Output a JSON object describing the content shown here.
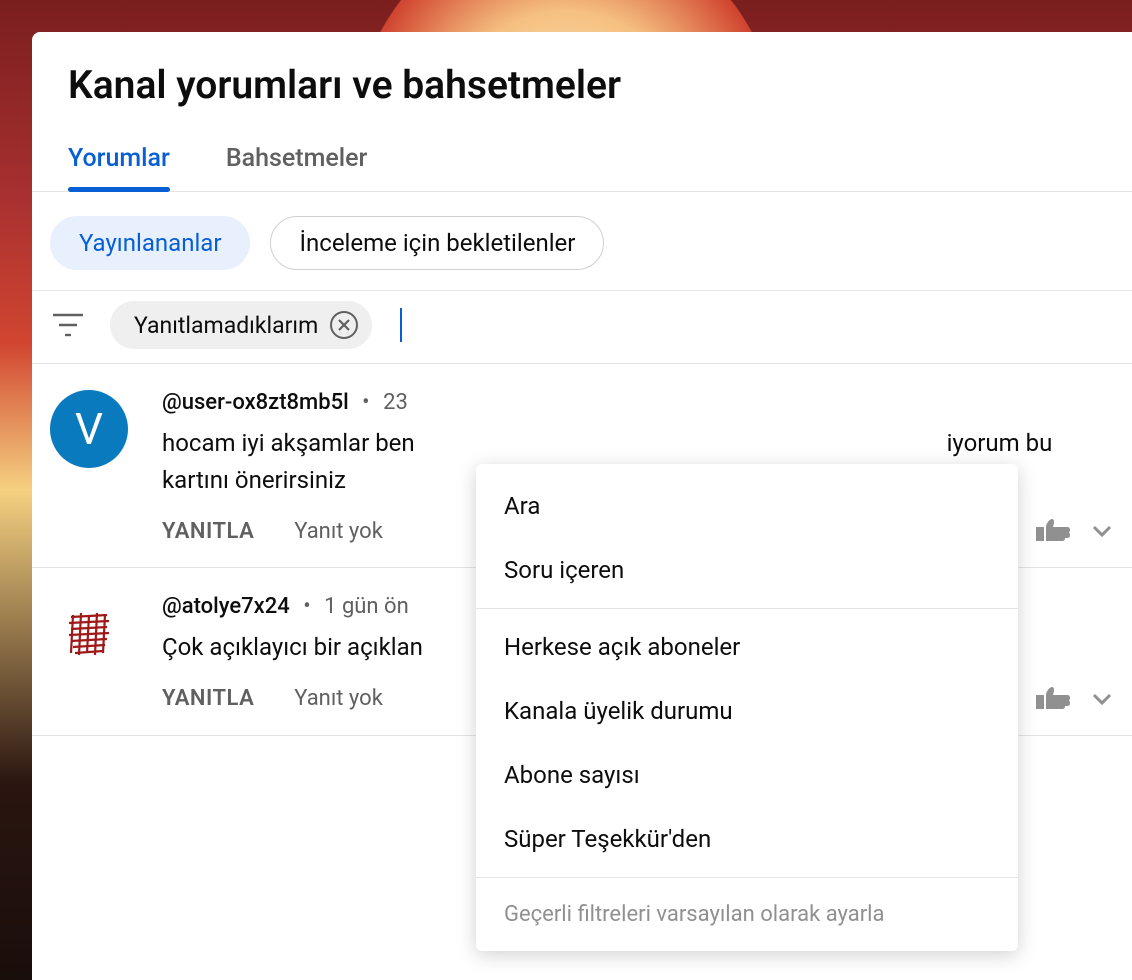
{
  "header": {
    "title": "Kanal yorumları ve bahsetmeler"
  },
  "tabs": [
    {
      "label": "Yorumlar",
      "active": true
    },
    {
      "label": "Bahsetmeler",
      "active": false
    }
  ],
  "status_chips": [
    {
      "label": "Yayınlananlar",
      "selected": true
    },
    {
      "label": "İnceleme için bekletilenler",
      "selected": false
    }
  ],
  "filter": {
    "active_chip": "Yanıtlamadıklarım"
  },
  "dropdown": {
    "items": [
      "Ara",
      "Soru içeren"
    ],
    "items2": [
      "Herkese açık aboneler",
      "Kanala üyelik durumu",
      "Abone sayısı",
      "Süper Teşekkür'den"
    ],
    "footer": "Geçerli filtreleri varsayılan olarak ayarla"
  },
  "comments": [
    {
      "avatar_letter": "V",
      "avatar_style": "blue",
      "user": "@user-ox8zt8mb5l",
      "time": "23",
      "text_prefix": "hocam iyi akşamlar ben ",
      "text_suffix": "iyorum bu",
      "text_line2": "kartını önerirsiniz",
      "reply_label": "YANITLA",
      "replies_meta": "Yanıt yok"
    },
    {
      "avatar_letter": "",
      "avatar_style": "scribble",
      "user": "@atolye7x24",
      "time": "1 gün ön",
      "text_prefix": "Çok açıklayıcı bir açıklan",
      "text_suffix": "",
      "text_line2": "",
      "reply_label": "YANITLA",
      "replies_meta": "Yanıt yok"
    }
  ]
}
